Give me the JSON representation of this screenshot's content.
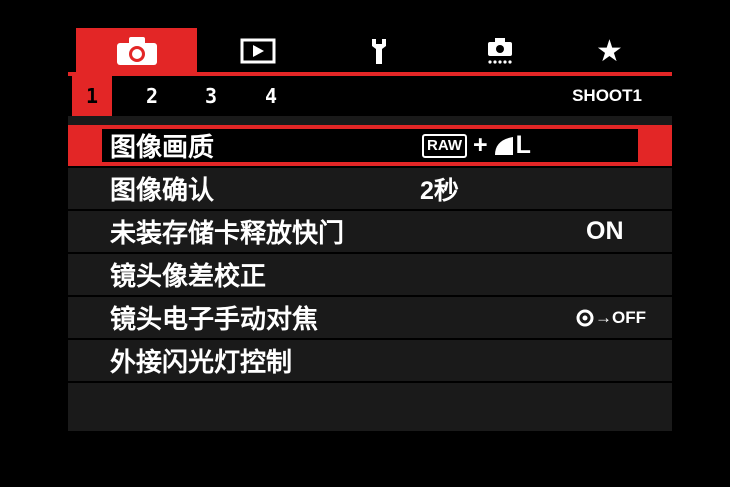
{
  "tabs": [
    {
      "icon": "camera-icon",
      "active": true
    },
    {
      "icon": "play-icon",
      "active": false
    },
    {
      "icon": "wrench-icon",
      "active": false
    },
    {
      "icon": "custom-icon",
      "active": false
    },
    {
      "icon": "star-icon",
      "active": false
    }
  ],
  "pages": [
    "1",
    "2",
    "3",
    "4"
  ],
  "active_page": "1",
  "section_label": "SHOOT1",
  "menu": [
    {
      "label": "图像画质",
      "value_raw": "RAW",
      "value_plus": "+",
      "value_size": "L",
      "selected": true
    },
    {
      "label": "图像确认",
      "value": "2秒"
    },
    {
      "label": "未装存储卡释放快门",
      "value": "ON"
    },
    {
      "label": "镜头像差校正",
      "value": ""
    },
    {
      "label": "镜头电子手动对焦",
      "value": "→OFF"
    },
    {
      "label": "外接闪光灯控制",
      "value": ""
    }
  ],
  "colors": {
    "accent": "#e32626",
    "panel": "#1a1a1a",
    "background": "#000000"
  }
}
